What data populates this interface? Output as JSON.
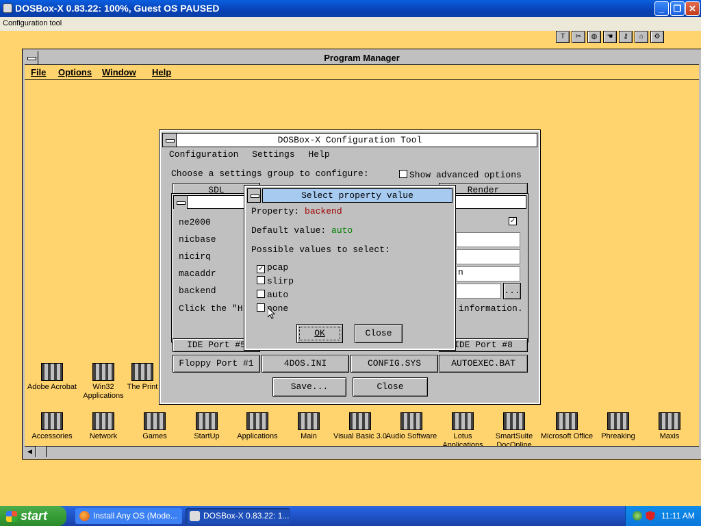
{
  "host": {
    "title": "DOSBox-X 0.83.22: 100%, Guest OS PAUSED",
    "menu_item": "Configuration tool",
    "controls": {
      "minimize": "_",
      "restore": "❐",
      "close": "✕"
    }
  },
  "guest": {
    "tool_strip_icons": [
      "tt-icon",
      "scissors-icon",
      "globe-icon",
      "hand-icon",
      "key-icon",
      "house-icon",
      "gear-icon"
    ],
    "program_manager": {
      "title": "Program Manager",
      "menu": [
        "File",
        "Options",
        "Window",
        "Help"
      ],
      "icons_row1": [
        "Adobe Acrobat",
        "Win32 Applications",
        "The Print"
      ],
      "icons_row2": [
        "Accessories",
        "Network",
        "Games",
        "StartUp",
        "Applications",
        "Main",
        "Visual Basic 3.0",
        "Audio Software",
        "Lotus Applications",
        "SmartSuite DocOnline",
        "Microsoft Office",
        "Phreaking",
        "Maxis"
      ]
    },
    "config_tool": {
      "title": "DOSBox-X Configuration Tool",
      "menu": [
        "Configuration",
        "Settings",
        "Help"
      ],
      "prompt": "Choose a settings group to configure:",
      "advanced_label": "Show advanced options",
      "group_buttons_top": [
        "SDL",
        "Render"
      ],
      "group_buttons_mid": [
        "IDE Port #5",
        "IDE Port #8"
      ],
      "group_buttons_bottom": [
        "Floppy Port #1",
        "4DOS.INI",
        "CONFIG.SYS",
        "AUTOEXEC.BAT"
      ],
      "save_label": "Save...",
      "close_label": "Close",
      "properties": [
        {
          "name": "ne2000",
          "value": ""
        },
        {
          "name": "nicbase",
          "value": ""
        },
        {
          "name": "nicirq",
          "value": ""
        },
        {
          "name": "macaddr",
          "value": "n"
        },
        {
          "name": "backend",
          "value": ""
        }
      ],
      "browse_label": "...",
      "help_text": "Click the \"H",
      "help_text_tail": "information."
    },
    "select_dialog": {
      "title": "Select property value",
      "property_label": "Property:",
      "property_value": "backend",
      "default_label": "Default value:",
      "default_value": "auto",
      "possible_label": "Possible values to select:",
      "options": [
        {
          "label": "pcap",
          "checked": "✓"
        },
        {
          "label": "slirp",
          "checked": ""
        },
        {
          "label": "auto",
          "checked": ""
        },
        {
          "label": "none",
          "checked": ""
        }
      ],
      "ok_label": "OK",
      "close_label": "Close"
    }
  },
  "taskbar": {
    "start_label": "start",
    "tasks": [
      "Install Any OS (Mode...",
      "DOSBox-X 0.83.22: 1..."
    ],
    "clock": "11:11 AM"
  },
  "colors": {
    "desktop": "#ffd36e",
    "window_face": "#c0c0c0",
    "dialog_title": "#a6caf0",
    "property_value": "#a00000",
    "default_value": "#008000"
  }
}
